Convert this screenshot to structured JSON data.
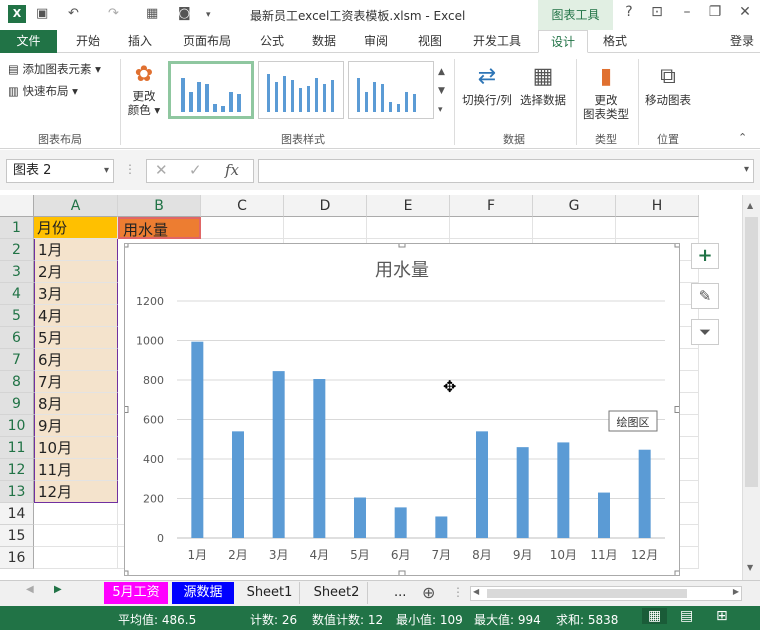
{
  "window": {
    "title": "最新员工excel工资表模板.xlsm - Excel",
    "context_tab": "图表工具",
    "help": "?",
    "signin": "登录"
  },
  "tabs": [
    "文件",
    "开始",
    "插入",
    "页面布局",
    "公式",
    "数据",
    "审阅",
    "视图",
    "开发工具",
    "设计",
    "格式"
  ],
  "ribbon": {
    "add_element": "添加图表元素",
    "quick_layout": "快速布局",
    "change_colors_1": "更改",
    "change_colors_2": "颜色",
    "switch_rowcol": "切换行/列",
    "select_data": "选择数据",
    "change_type_1": "更改",
    "change_type_2": "图表类型",
    "move_chart": "移动图表",
    "groups": {
      "layout": "图表布局",
      "styles": "图表样式",
      "data": "数据",
      "type": "类型",
      "location": "位置"
    }
  },
  "formula_bar": {
    "name_box": "图表 2",
    "fx": "fx",
    "cancel": "✕",
    "confirm": "✓",
    "formula": ""
  },
  "columns": [
    "A",
    "B",
    "C",
    "D",
    "E",
    "F",
    "G",
    "H"
  ],
  "rows": [
    "1",
    "2",
    "3",
    "4",
    "5",
    "6",
    "7",
    "8",
    "9",
    "10",
    "11",
    "12",
    "13",
    "14",
    "15",
    "16"
  ],
  "cells": {
    "a1": "月份",
    "b1": "用水量",
    "months": [
      "1月",
      "2月",
      "3月",
      "4月",
      "5月",
      "6月",
      "7月",
      "8月",
      "9月",
      "10月",
      "11月",
      "12月"
    ]
  },
  "chart_tooltip": "绘图区",
  "chart_data": {
    "type": "bar",
    "title": "用水量",
    "categories": [
      "1月",
      "2月",
      "3月",
      "4月",
      "5月",
      "6月",
      "7月",
      "8月",
      "9月",
      "10月",
      "11月",
      "12月"
    ],
    "values": [
      994,
      540,
      845,
      805,
      205,
      155,
      109,
      540,
      460,
      484,
      230,
      447
    ],
    "ylim": [
      0,
      1200
    ],
    "yticks": [
      0,
      200,
      400,
      600,
      800,
      1000,
      1200
    ],
    "xlabel": "",
    "ylabel": "",
    "grid": true,
    "color": "#5b9bd5"
  },
  "sheets": [
    "5月工资",
    "源数据",
    "Sheet1",
    "Sheet2"
  ],
  "sheet_colors": {
    "5月工资": "#ff00ff",
    "源数据": "#0000ff"
  },
  "sheet_more": "...",
  "status": {
    "average": "平均值: 486.5",
    "count": "计数: 26",
    "numcount": "数值计数: 12",
    "min": "最小值: 109",
    "max": "最大值: 994",
    "sum": "求和: 5838"
  }
}
